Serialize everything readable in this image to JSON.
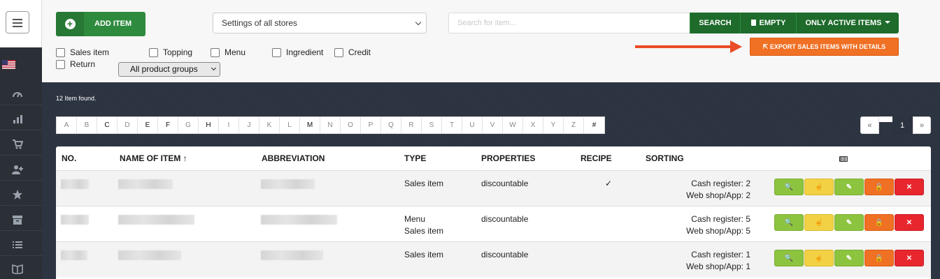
{
  "sidebar": {
    "icons": [
      "menu-icon",
      "us-flag-icon",
      "speedometer-icon",
      "bar-chart-icon",
      "cart-icon",
      "add-user-icon",
      "star-icon",
      "archive-icon",
      "list-icon",
      "book-icon"
    ]
  },
  "toolbar": {
    "add_item_label": "ADD ITEM",
    "store_select_value": "Settings of all stores",
    "search_placeholder": "Search for item...",
    "search_label": "SEARCH",
    "empty_label": "EMPTY",
    "only_active_label": "ONLY ACTIVE ITEMS",
    "export_label": "EXPORT SALES ITEMS WITH DETAILS"
  },
  "filters": {
    "checkboxes": [
      "Sales item",
      "Topping",
      "Menu",
      "Ingredient",
      "Credit",
      "Return"
    ],
    "product_group_value": "All product groups"
  },
  "results": {
    "count_text": "12 Item found.",
    "alphabet": [
      "A",
      "B",
      "C",
      "D",
      "E",
      "F",
      "G",
      "H",
      "I",
      "J",
      "K",
      "L",
      "M",
      "N",
      "O",
      "P",
      "Q",
      "R",
      "S",
      "T",
      "U",
      "V",
      "W",
      "X",
      "Y",
      "Z",
      "#"
    ],
    "pager": {
      "prev": "«",
      "current": "1",
      "next": "»"
    }
  },
  "table": {
    "headers": {
      "no": "NO.",
      "name": "NAME OF ITEM ↑",
      "abbreviation": "ABBREVIATION",
      "type": "TYPE",
      "properties": "PROPERTIES",
      "recipe": "RECIPE",
      "sorting": "SORTING"
    },
    "rows": [
      {
        "type_1": "Sales item",
        "type_2": "",
        "properties": "discountable",
        "recipe": "✓",
        "sort_1": "Cash register: 2",
        "sort_2": "Web shop/App: 2"
      },
      {
        "type_1": "Menu",
        "type_2": "Sales item",
        "properties": "discountable",
        "recipe": "",
        "sort_1": "Cash register: 5",
        "sort_2": "Web shop/App: 5"
      },
      {
        "type_1": "Sales item",
        "type_2": "",
        "properties": "discountable",
        "recipe": "",
        "sort_1": "Cash register: 1",
        "sort_2": "Web shop/App: 1"
      }
    ],
    "actions": [
      "search-icon",
      "hand-icon",
      "pencil-icon",
      "lock-icon",
      "x-icon"
    ],
    "action_glyphs": [
      "🔍",
      "☝",
      "✎",
      "🔒",
      "✕"
    ]
  },
  "colors": {
    "green_dark": "#1e6b2b",
    "green": "#2e8b3d",
    "orange": "#f07024",
    "red_arrow": "#e94c26",
    "panel": "#2c3340"
  }
}
